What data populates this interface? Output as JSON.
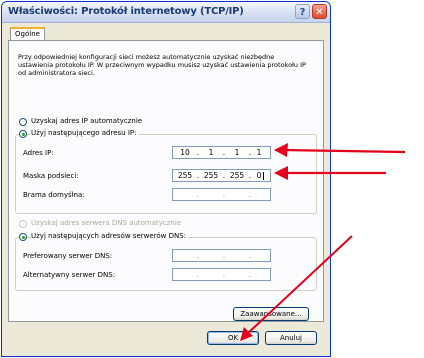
{
  "window": {
    "title": "Właściwości: Protokół internetowy (TCP/IP)",
    "help_glyph": "?",
    "close_glyph": "✕"
  },
  "tab": {
    "label": "Ogólne"
  },
  "description": "Przy odpowiedniej konfiguracji sieci możesz automatycznie uzyskać niezbędne ustawienia protokołu IP. W przeciwnym wypadku musisz uzyskać ustawienia protokołu IP od administratora sieci.",
  "ip_section": {
    "auto_label": "Uzyskaj adres IP automatycznie",
    "manual_label": "Użyj następującego adresu IP:",
    "fields": [
      {
        "label": "Adres IP:",
        "octets": [
          "10",
          "1",
          "1",
          "1"
        ]
      },
      {
        "label": "Maska podsieci:",
        "octets": [
          "255",
          "255",
          "255",
          "0"
        ]
      },
      {
        "label": "Brama domyślna:",
        "octets": [
          "",
          "",
          "",
          ""
        ]
      }
    ]
  },
  "dns_section": {
    "auto_label": "Uzyskaj adres serwera DNS automatycznie",
    "manual_label": "Użyj następujących adresów serwerów DNS:",
    "fields": [
      {
        "label": "Preferowany serwer DNS:",
        "octets": [
          "",
          "",
          "",
          ""
        ]
      },
      {
        "label": "Alternatywny serwer DNS:",
        "octets": [
          "",
          "",
          "",
          ""
        ]
      }
    ]
  },
  "buttons": {
    "advanced": "Zaawansowane...",
    "ok": "OK",
    "cancel": "Anuluj"
  },
  "colors": {
    "arrow": "#e3001b",
    "title_text": "#1b3a7a",
    "dialog_bg": "#ece9d8"
  }
}
